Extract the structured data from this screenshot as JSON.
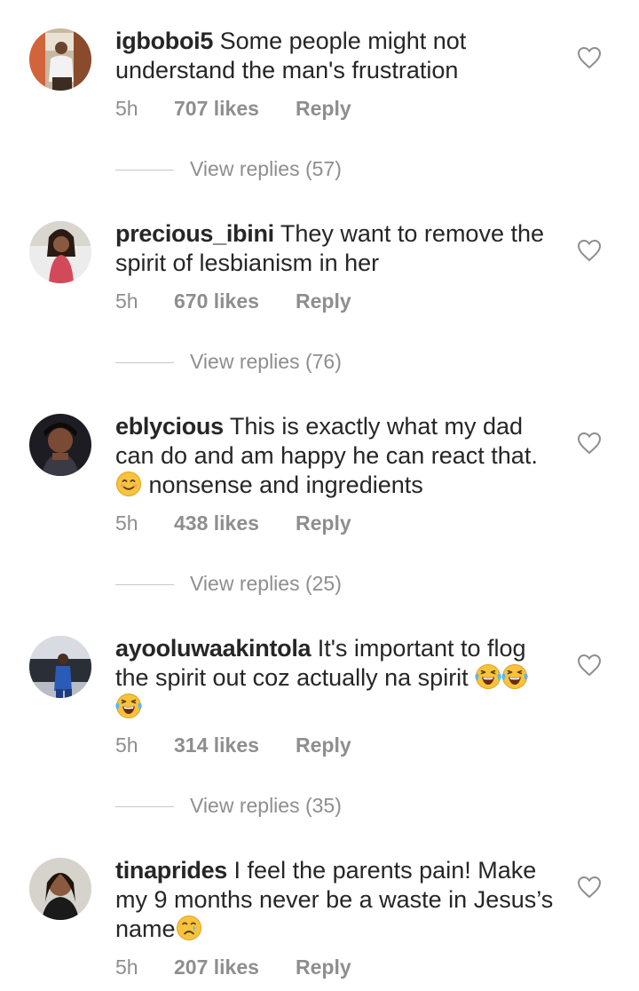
{
  "comments": [
    {
      "username": "igboboi5",
      "text": " Some people might not understand the man's frustration",
      "time": "5h",
      "likes": "707 likes",
      "reply": "Reply",
      "view_replies": "View replies (57)"
    },
    {
      "username": "precious_ibini",
      "text": " They want to remove the spirit of lesbianism in her",
      "time": "5h",
      "likes": "670 likes",
      "reply": "Reply",
      "view_replies": "View replies (76)"
    },
    {
      "username": "eblycious",
      "text": " This is exactly what my dad can do and am happy he can react that.",
      "text_after_emoji": " nonsense and ingredients",
      "emoji": "smiling-face",
      "time": "5h",
      "likes": "438 likes",
      "reply": "Reply",
      "view_replies": "View replies (25)"
    },
    {
      "username": "ayooluwaakintola",
      "text": " It's important to flog the spirit out coz actually na spirit",
      "emoji": "tears-of-joy x3",
      "time": "5h",
      "likes": "314 likes",
      "reply": "Reply",
      "view_replies": "View replies (35)"
    },
    {
      "username": "tinaprides",
      "text": " I feel the parents pain! Make my 9 months never be a waste in Jesus’s name",
      "emoji": "crying-face",
      "time": "5h",
      "likes": "207 likes",
      "reply": "Reply"
    }
  ],
  "colors": {
    "text": "#262626",
    "secondary": "#8e8e8e",
    "divider": "#c7c7c7",
    "emoji_yellow": "#f7c33d"
  },
  "icons": {
    "like": "heart-outline-icon"
  }
}
